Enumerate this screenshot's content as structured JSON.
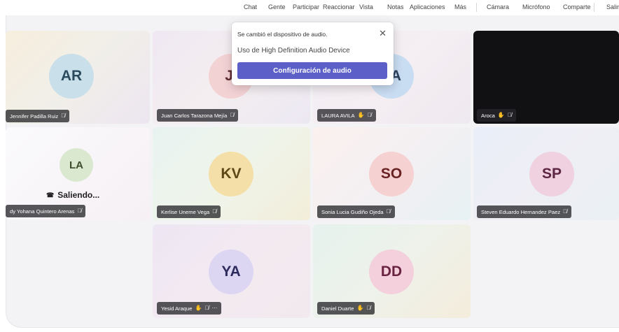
{
  "toolbar": {
    "items": [
      "Chat",
      "Gente",
      "Participar",
      "Reaccionar",
      "Vista",
      "Notas",
      "Aplicaciones",
      "Más",
      "Cámara",
      "Micrófono",
      "Comparte",
      "Salir"
    ]
  },
  "popup": {
    "title": "Se cambió el dispositivo de audio.",
    "close_icon": "✕",
    "message": "Uso de High Definition Audio Device",
    "button": "Configuración de audio"
  },
  "participants": [
    {
      "initials": "AR",
      "name": "Jennifer Padilla Ruiz"
    },
    {
      "initials": "JI",
      "name": "Juan Carlos Tarazona Mejía"
    },
    {
      "initials": "LA",
      "name": "LAURA AVILA"
    },
    {
      "initials": "",
      "name": "Aroca"
    },
    {
      "initials": "LA",
      "name": "dy Yohana Quintero Arenas",
      "status": "Saliendo..."
    },
    {
      "initials": "KV",
      "name": "Kerlise Uneme Vega"
    },
    {
      "initials": "SO",
      "name": "Sonia Lucia Gudiño Ojeda"
    },
    {
      "initials": "SP",
      "name": "Steven Eduardo Hernandez Paez"
    },
    {
      "initials": "YA",
      "name": "Yesid Araque"
    },
    {
      "initials": "DD",
      "name": "Daniel Duarte"
    }
  ],
  "icons": {
    "mic_off": "mic-off-icon",
    "hand": "raised-hand-icon",
    "more": "more-options-icon",
    "leave": "hang-up-icon"
  },
  "glyphs": {
    "mic_off": "🎙̸",
    "hand": "✋",
    "more": "···",
    "leave": "☎"
  },
  "colors": {
    "accent": "#5b5fc7",
    "avatar_AR": "#c9dfe9",
    "avatar_JI": "#f3d2d4",
    "avatar_LA_top": "#c8dcf2",
    "avatar_LA_mid": "#dbe8d0",
    "avatar_KV": "#f5dfa8",
    "avatar_SO": "#f6d1d1",
    "avatar_SP": "#efd1df",
    "avatar_YA": "#dcd6f3",
    "avatar_DD": "#f4cfdc"
  }
}
